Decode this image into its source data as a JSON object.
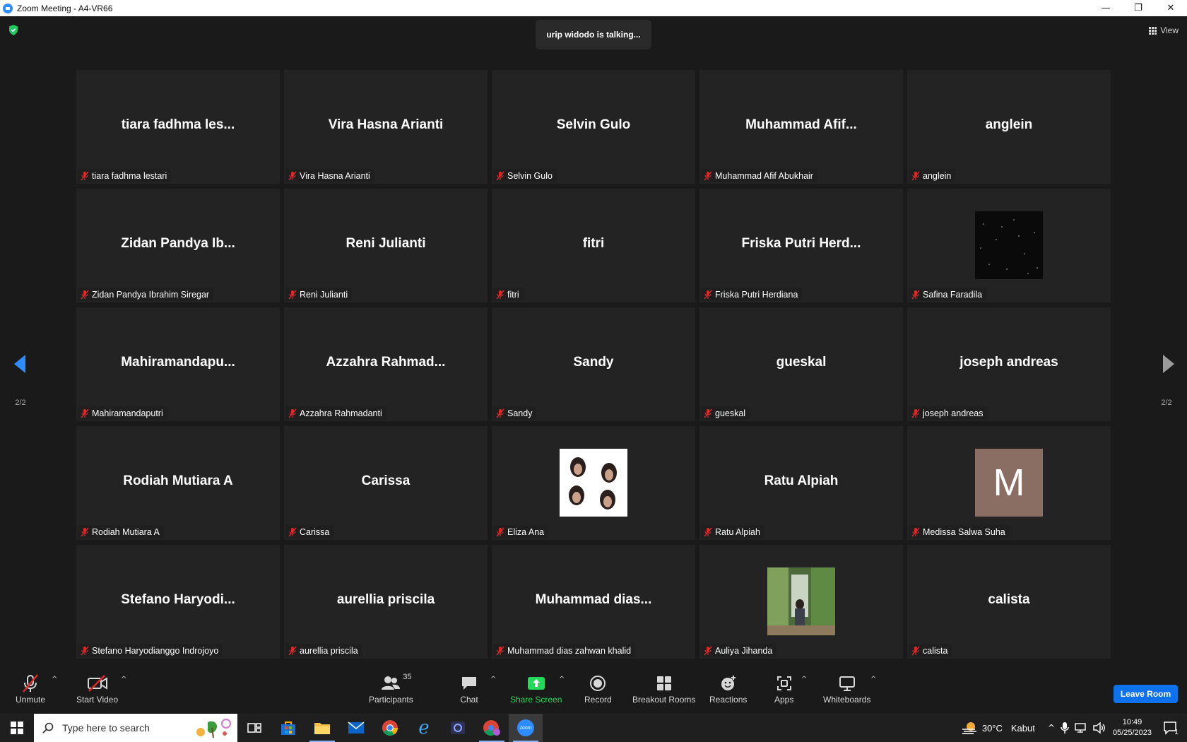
{
  "window": {
    "title": "Zoom Meeting - A4-VR66",
    "minimize": "—",
    "restore": "❐",
    "close": "✕"
  },
  "meeting": {
    "talking": "urip widodo is talking...",
    "view_label": "View",
    "page_left": "2/2",
    "page_right": "2/2",
    "tiles": [
      {
        "display": "tiara fadhma les...",
        "label": "tiara fadhma lestari",
        "kind": "name"
      },
      {
        "display": "Vira Hasna Arianti",
        "label": "Vira Hasna Arianti",
        "kind": "name"
      },
      {
        "display": "Selvin Gulo",
        "label": "Selvin Gulo",
        "kind": "name"
      },
      {
        "display": "Muhammad  Afif...",
        "label": "Muhammad Afif Abukhair",
        "kind": "name"
      },
      {
        "display": "anglein",
        "label": "anglein",
        "kind": "name"
      },
      {
        "display": "Zidan Pandya Ib...",
        "label": "Zidan Pandya Ibrahim Siregar",
        "kind": "name"
      },
      {
        "display": "Reni Julianti",
        "label": "Reni Julianti",
        "kind": "name"
      },
      {
        "display": "fitri",
        "label": "fitri",
        "kind": "name"
      },
      {
        "display": "Friska Putri Herd...",
        "label": "Friska Putri Herdiana",
        "kind": "name"
      },
      {
        "display": "",
        "label": "Safina Faradila",
        "kind": "stars"
      },
      {
        "display": "Mahiramandapu...",
        "label": "Mahiramandaputri",
        "kind": "name"
      },
      {
        "display": "Azzahra  Rahmad...",
        "label": "Azzahra Rahmadanti",
        "kind": "name"
      },
      {
        "display": "Sandy",
        "label": "Sandy",
        "kind": "name"
      },
      {
        "display": "gueskal",
        "label": "gueskal",
        "kind": "name"
      },
      {
        "display": "joseph andreas",
        "label": "joseph andreas",
        "kind": "name"
      },
      {
        "display": "Rodiah Mutiara A",
        "label": "Rodiah Mutiara A",
        "kind": "name"
      },
      {
        "display": "Carissa",
        "label": "Carissa",
        "kind": "name"
      },
      {
        "display": "",
        "label": "Eliza Ana",
        "kind": "collage"
      },
      {
        "display": "Ratu Alpiah",
        "label": "Ratu Alpiah",
        "kind": "name"
      },
      {
        "display": "M",
        "label": "Medissa Salwa Suha",
        "kind": "letter"
      },
      {
        "display": "Stefano  Haryodi...",
        "label": "Stefano Haryodianggo Indrojoyo",
        "kind": "name"
      },
      {
        "display": "aurellia priscila",
        "label": "aurellia priscila",
        "kind": "name"
      },
      {
        "display": "Muhammad  dias...",
        "label": "Muhammad dias zahwan khalid",
        "kind": "name"
      },
      {
        "display": "",
        "label": "Auliya Jihanda",
        "kind": "photo"
      },
      {
        "display": "calista",
        "label": "calista",
        "kind": "name"
      }
    ]
  },
  "toolbar": {
    "unmute": "Unmute",
    "start_video": "Start Video",
    "participants": "Participants",
    "participants_count": "35",
    "chat": "Chat",
    "share_screen": "Share Screen",
    "record": "Record",
    "breakout_rooms": "Breakout Rooms",
    "reactions": "Reactions",
    "apps": "Apps",
    "whiteboards": "Whiteboards",
    "leave_room": "Leave Room"
  },
  "taskbar": {
    "search_placeholder": "Type here to search",
    "weather_temp": "30°C",
    "weather_desc": "Kabut",
    "time": "10:49",
    "date": "05/25/2023",
    "notif_count": "1",
    "zoom_label": "zoom"
  },
  "colors": {
    "accent_blue": "#0e72ed",
    "share_green": "#23d959",
    "mic_red": "#e02828",
    "tile_bg": "#232323"
  }
}
